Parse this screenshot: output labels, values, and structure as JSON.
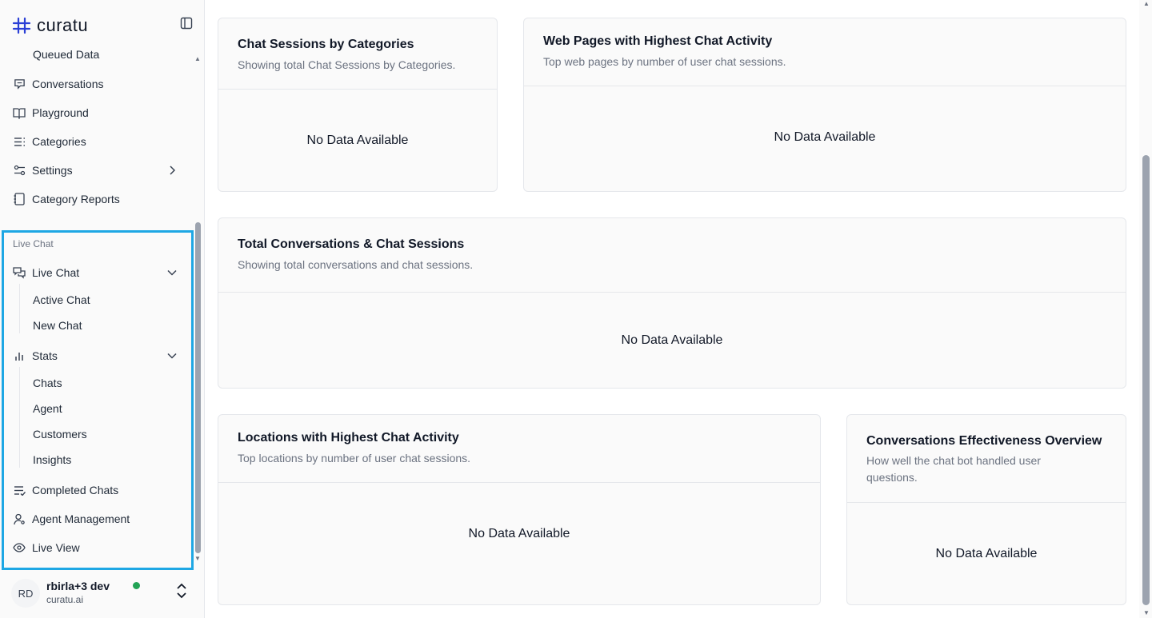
{
  "brand": {
    "name": "curatu"
  },
  "sidebar": {
    "top_items": [
      {
        "label": "Queued Data"
      },
      {
        "label": "Conversations"
      },
      {
        "label": "Playground"
      },
      {
        "label": "Categories"
      },
      {
        "label": "Settings"
      },
      {
        "label": "Category Reports"
      }
    ],
    "live_chat_section": {
      "label": "Live Chat",
      "live_chat": {
        "label": "Live Chat",
        "children": [
          "Active Chat",
          "New Chat"
        ]
      },
      "stats": {
        "label": "Stats",
        "children": [
          "Chats",
          "Agent",
          "Customers",
          "Insights"
        ]
      },
      "completed_chats": "Completed Chats",
      "agent_management": "Agent Management",
      "live_view": "Live View"
    }
  },
  "user": {
    "initials": "RD",
    "name": "rbirla+3 dev",
    "domain": "curatu.ai",
    "status_color": "#22a355"
  },
  "cards": {
    "categories": {
      "title": "Chat Sessions by Categories",
      "subtitle": "Showing total Chat Sessions by Categories.",
      "empty": "No Data Available"
    },
    "web_pages": {
      "title": "Web Pages with Highest Chat Activity",
      "subtitle": "Top web pages by number of user chat sessions.",
      "empty": "No Data Available"
    },
    "totals": {
      "title": "Total Conversations & Chat Sessions",
      "subtitle": "Showing total conversations and chat sessions.",
      "empty": "No Data Available"
    },
    "locations": {
      "title": "Locations with Highest Chat Activity",
      "subtitle": "Top locations by number of user chat sessions.",
      "empty": "No Data Available"
    },
    "effectiveness": {
      "title": "Conversations Effectiveness Overview",
      "subtitle_line1": "How well the chat bot handled user",
      "subtitle_line2": "questions.",
      "empty": "No Data Available"
    }
  },
  "colors": {
    "highlight": "#1ea7e4",
    "logo": "#2b3fd6"
  },
  "icons": [
    "logo-icon",
    "sidebar-toggle-icon",
    "conversations-icon",
    "playground-icon",
    "categories-icon",
    "settings-icon",
    "chevron-right-icon",
    "category-reports-icon",
    "live-chat-icon",
    "chevron-down-icon",
    "stats-icon",
    "completed-chats-icon",
    "agent-management-icon",
    "eye-icon",
    "chevron-up-down-icon"
  ]
}
